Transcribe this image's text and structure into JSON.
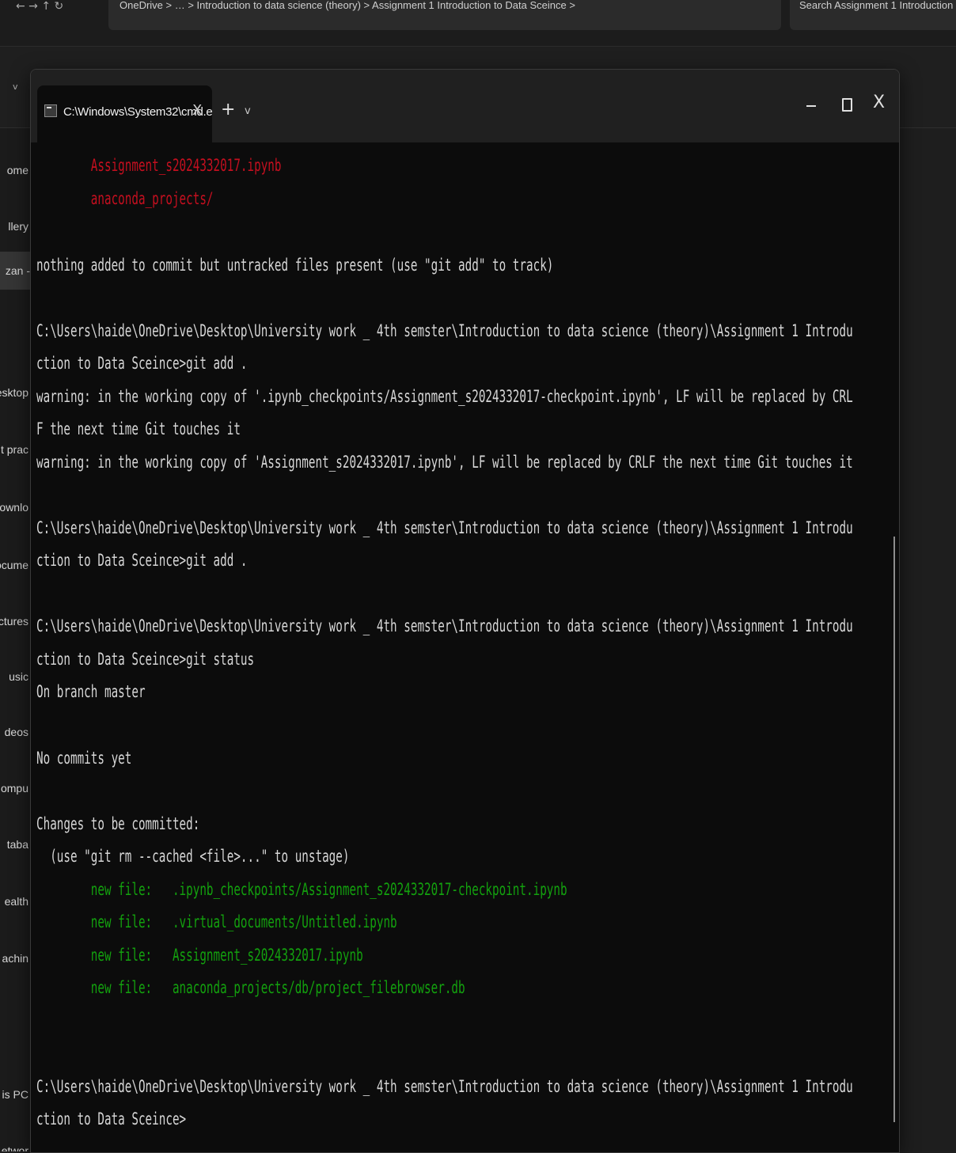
{
  "background": {
    "address_bar_text": "OneDrive  >  …  >  Introduction to data science (theory)  >  Assignment 1 Introduction to Data Sceince  >",
    "search_placeholder": "Search Assignment 1 Introduction",
    "sidebar_items": [
      "ome",
      "llery",
      "zan -",
      "esktop",
      "t prac",
      "ownlo",
      "ocume",
      "ctures",
      "usic",
      "deos",
      "ompu",
      "taba",
      "ealth",
      "achin",
      "is PC",
      "etwor"
    ]
  },
  "terminal": {
    "tab_title": "C:\\Windows\\System32\\cmd.e",
    "tab_close": "X",
    "new_tab": "+",
    "dropdown": "v",
    "close_glyph": "X",
    "lines": [
      {
        "text": "        Assignment_s2024332017.ipynb",
        "color": "red"
      },
      {
        "text": "        anaconda_projects/",
        "color": "red"
      },
      {
        "text": "",
        "color": "default"
      },
      {
        "text": "nothing added to commit but untracked files present (use \"git add\" to track)",
        "color": "default"
      },
      {
        "text": "",
        "color": "default"
      },
      {
        "text": "C:\\Users\\haide\\OneDrive\\Desktop\\University work _ 4th semster\\Introduction to data science (theory)\\Assignment 1 Introdu",
        "color": "default"
      },
      {
        "text": "ction to Data Sceince>git add .",
        "color": "default"
      },
      {
        "text": "warning: in the working copy of '.ipynb_checkpoints/Assignment_s2024332017-checkpoint.ipynb', LF will be replaced by CRL",
        "color": "default"
      },
      {
        "text": "F the next time Git touches it",
        "color": "default"
      },
      {
        "text": "warning: in the working copy of 'Assignment_s2024332017.ipynb', LF will be replaced by CRLF the next time Git touches it",
        "color": "default"
      },
      {
        "text": "",
        "color": "default"
      },
      {
        "text": "C:\\Users\\haide\\OneDrive\\Desktop\\University work _ 4th semster\\Introduction to data science (theory)\\Assignment 1 Introdu",
        "color": "default"
      },
      {
        "text": "ction to Data Sceince>git add .",
        "color": "default"
      },
      {
        "text": "",
        "color": "default"
      },
      {
        "text": "C:\\Users\\haide\\OneDrive\\Desktop\\University work _ 4th semster\\Introduction to data science (theory)\\Assignment 1 Introdu",
        "color": "default"
      },
      {
        "text": "ction to Data Sceince>git status",
        "color": "default"
      },
      {
        "text": "On branch master",
        "color": "default"
      },
      {
        "text": "",
        "color": "default"
      },
      {
        "text": "No commits yet",
        "color": "default"
      },
      {
        "text": "",
        "color": "default"
      },
      {
        "text": "Changes to be committed:",
        "color": "default"
      },
      {
        "text": "  (use \"git rm --cached <file>...\" to unstage)",
        "color": "default"
      },
      {
        "text": "        new file:   .ipynb_checkpoints/Assignment_s2024332017-checkpoint.ipynb",
        "color": "green"
      },
      {
        "text": "        new file:   .virtual_documents/Untitled.ipynb",
        "color": "green"
      },
      {
        "text": "        new file:   Assignment_s2024332017.ipynb",
        "color": "green"
      },
      {
        "text": "        new file:   anaconda_projects/db/project_filebrowser.db",
        "color": "green"
      },
      {
        "text": "",
        "color": "default"
      },
      {
        "text": "",
        "color": "default"
      },
      {
        "text": "C:\\Users\\haide\\OneDrive\\Desktop\\University work _ 4th semster\\Introduction to data science (theory)\\Assignment 1 Introdu",
        "color": "default"
      },
      {
        "text": "ction to Data Sceince>",
        "color": "default"
      }
    ]
  }
}
